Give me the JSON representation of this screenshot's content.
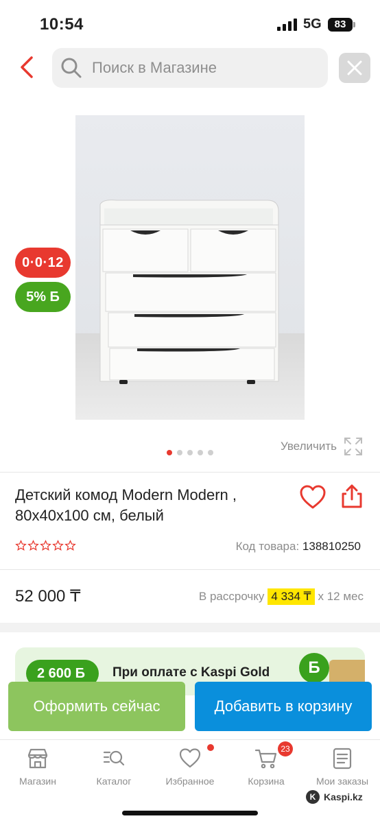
{
  "status_bar": {
    "time": "10:54",
    "network": "5G",
    "battery": "83"
  },
  "header": {
    "search_placeholder": "Поиск в Магазине"
  },
  "gallery": {
    "badge_installment": "0·0·12",
    "badge_bonus": "5% Б",
    "zoom_label": "Увеличить",
    "dot_count": 5,
    "active_dot": 0
  },
  "product": {
    "title": "Детский комод Modern Modern , 80х40х100 см, белый",
    "rating_stars": 0,
    "code_label": "Код товара:",
    "code_value": "138810250",
    "price": "52 000 ₸",
    "installment_prefix": "В рассрочку",
    "installment_amount": "4 334 ₸",
    "installment_suffix": "х 12 мес"
  },
  "promo": {
    "badge": "2 600 Б",
    "text": "При оплате с Kaspi Gold",
    "coin": "Б"
  },
  "actions": {
    "buy_now": "Оформить сейчас",
    "add_to_cart": "Добавить в корзину"
  },
  "tabbar": {
    "items": [
      {
        "label": "Магазин",
        "icon": "shop-icon"
      },
      {
        "label": "Каталог",
        "icon": "catalog-search-icon"
      },
      {
        "label": "Избранное",
        "icon": "heart-icon"
      },
      {
        "label": "Корзина",
        "icon": "cart-icon",
        "badge": "23"
      },
      {
        "label": "Мои заказы",
        "icon": "orders-icon"
      }
    ]
  },
  "watermark": "Kaspi.kz",
  "colors": {
    "accent_red": "#e8392f",
    "green": "#48a61f",
    "blue": "#0a8fdc",
    "light_green": "#8dc55e",
    "highlight_yellow": "#ffe600"
  }
}
